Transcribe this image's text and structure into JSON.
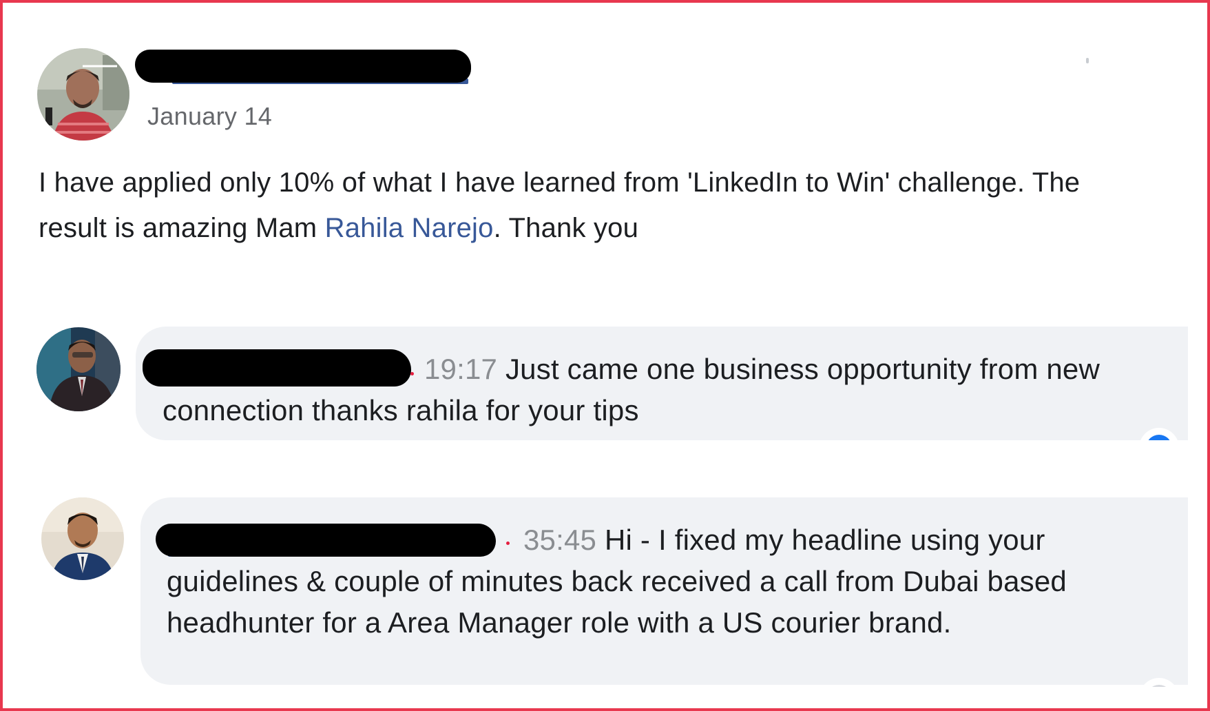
{
  "post": {
    "date": "January 14",
    "body_before_mention": "I have applied only 10% of what I have learned from 'LinkedIn to Win' challenge. The result is amazing Mam ",
    "mention": "Rahila Narejo",
    "body_after_mention": ". Thank you"
  },
  "comments": [
    {
      "timestamp": "19:17",
      "text": "Just came one business opportunity from new connection thanks rahila for your tips"
    },
    {
      "timestamp": "35:45",
      "text": "Hi - I fixed my headline using your guidelines & couple of minutes back received a call from Dubai based headhunter for a Area Manager role with a US courier brand."
    }
  ],
  "colors": {
    "frame_border": "#e8384f",
    "mention": "#385898",
    "bubble": "#f0f2f5",
    "timestamp": "#8a8d91",
    "redaction": "#000000"
  }
}
